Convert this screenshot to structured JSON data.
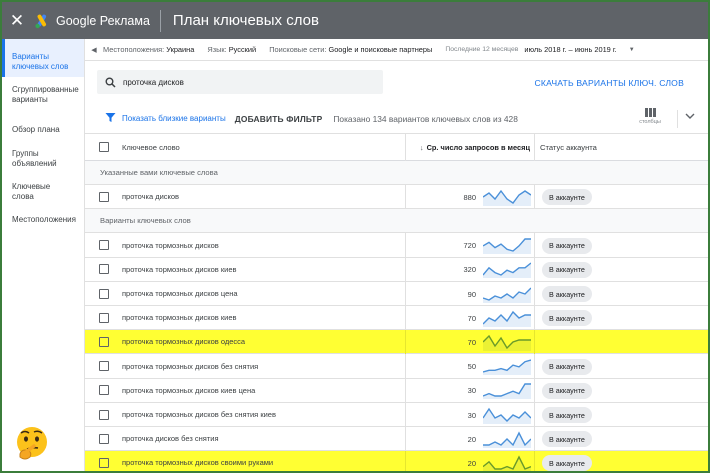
{
  "header": {
    "close_label": "✕",
    "brand": "Google Реклама",
    "title": "План ключевых слов"
  },
  "sidebar": {
    "items": [
      {
        "label": "Варианты ключевых слов",
        "active": true
      },
      {
        "label": "Сгруппированные варианты",
        "active": false
      },
      {
        "label": "Обзор плана",
        "active": false
      },
      {
        "label": "Группы объявлений",
        "active": false
      },
      {
        "label": "Ключевые слова",
        "active": false
      },
      {
        "label": "Местоположения",
        "active": false
      }
    ]
  },
  "filters": {
    "location_label": "Местоположения:",
    "location_value": "Украина",
    "language_label": "Язык:",
    "language_value": "Русский",
    "network_label": "Поисковые сети:",
    "network_value": "Google и поисковые партнеры",
    "period_label": "Последние 12 месяцев",
    "period_value": "июль 2018 г. – июнь 2019 г."
  },
  "search": {
    "value": "проточка дисков",
    "download_label": "СКАЧАТЬ ВАРИАНТЫ КЛЮЧ. СЛОВ"
  },
  "toolbar": {
    "near_variants_label": "Показать близкие варианты",
    "add_filter_label": "ДОБАВИТЬ ФИЛЬТР",
    "count_text": "Показано 134 вариантов ключевых слов из 428",
    "columns_label": "столбцы"
  },
  "table": {
    "headers": {
      "keyword": "Ключевое слово",
      "volume": "Ср. число запросов в месяц",
      "account": "Статус аккаунта"
    },
    "group_provided": "Указанные вами ключевые слова",
    "group_variants": "Варианты ключевых слов",
    "provided": [
      {
        "keyword": "проточка дисков",
        "volume": "880",
        "account": "В аккаунте",
        "trend": [
          6,
          8,
          5,
          9,
          5,
          3,
          7,
          9,
          7
        ]
      }
    ],
    "variants": [
      {
        "keyword": "проточка тормозных дисков",
        "volume": "720",
        "account": "В аккаунте",
        "highlight": false,
        "trend": [
          5,
          7,
          4,
          6,
          3,
          2,
          5,
          9,
          9
        ]
      },
      {
        "keyword": "проточка тормозных дисков киев",
        "volume": "320",
        "account": "В аккаунте",
        "highlight": false,
        "trend": [
          3,
          6,
          4,
          3,
          5,
          4,
          6,
          6,
          8
        ]
      },
      {
        "keyword": "проточка тормозных дисков цена",
        "volume": "90",
        "account": "В аккаунте",
        "highlight": false,
        "trend": [
          3,
          2,
          4,
          3,
          5,
          3,
          6,
          5,
          8
        ]
      },
      {
        "keyword": "проточка тормозных дисков киев",
        "volume": "70",
        "account": "В аккаунте",
        "highlight": false,
        "trend": [
          3,
          5,
          4,
          6,
          4,
          7,
          5,
          6,
          6
        ]
      },
      {
        "keyword": "проточка тормозных дисков одесса",
        "volume": "70",
        "account": "",
        "highlight": true,
        "trend": [
          6,
          9,
          4,
          8,
          3,
          6,
          7,
          7,
          7
        ]
      },
      {
        "keyword": "проточка тормозных дисков без снятия",
        "volume": "50",
        "account": "В аккаунте",
        "highlight": false,
        "trend": [
          2,
          3,
          3,
          4,
          3,
          6,
          5,
          8,
          9
        ]
      },
      {
        "keyword": "проточка тормозных дисков киев цена",
        "volume": "30",
        "account": "В аккаунте",
        "highlight": false,
        "trend": [
          3,
          4,
          3,
          3,
          4,
          5,
          4,
          8,
          8
        ]
      },
      {
        "keyword": "проточка тормозных дисков без снятия киев",
        "volume": "30",
        "account": "В аккаунте",
        "highlight": false,
        "trend": [
          5,
          8,
          5,
          6,
          4,
          6,
          5,
          7,
          5
        ]
      },
      {
        "keyword": "проточка дисков без снятия",
        "volume": "20",
        "account": "В аккаунте",
        "highlight": false,
        "trend": [
          3,
          3,
          4,
          3,
          5,
          3,
          7,
          3,
          5
        ]
      },
      {
        "keyword": "проточка тормозных дисков своими руками",
        "volume": "20",
        "account": "В аккаунте",
        "highlight": true,
        "trend": [
          4,
          6,
          3,
          3,
          4,
          3,
          8,
          3,
          4
        ]
      }
    ]
  },
  "colors": {
    "accent": "#1a73e8",
    "highlight": "#ffff33",
    "topbar": "#5f6368",
    "spark": "#4a90d9"
  },
  "icons": {
    "search": "search-icon",
    "filter": "filter-icon",
    "columns": "columns-icon",
    "chevron": "chevron-down-icon",
    "emoji": "thinking-face-icon"
  }
}
